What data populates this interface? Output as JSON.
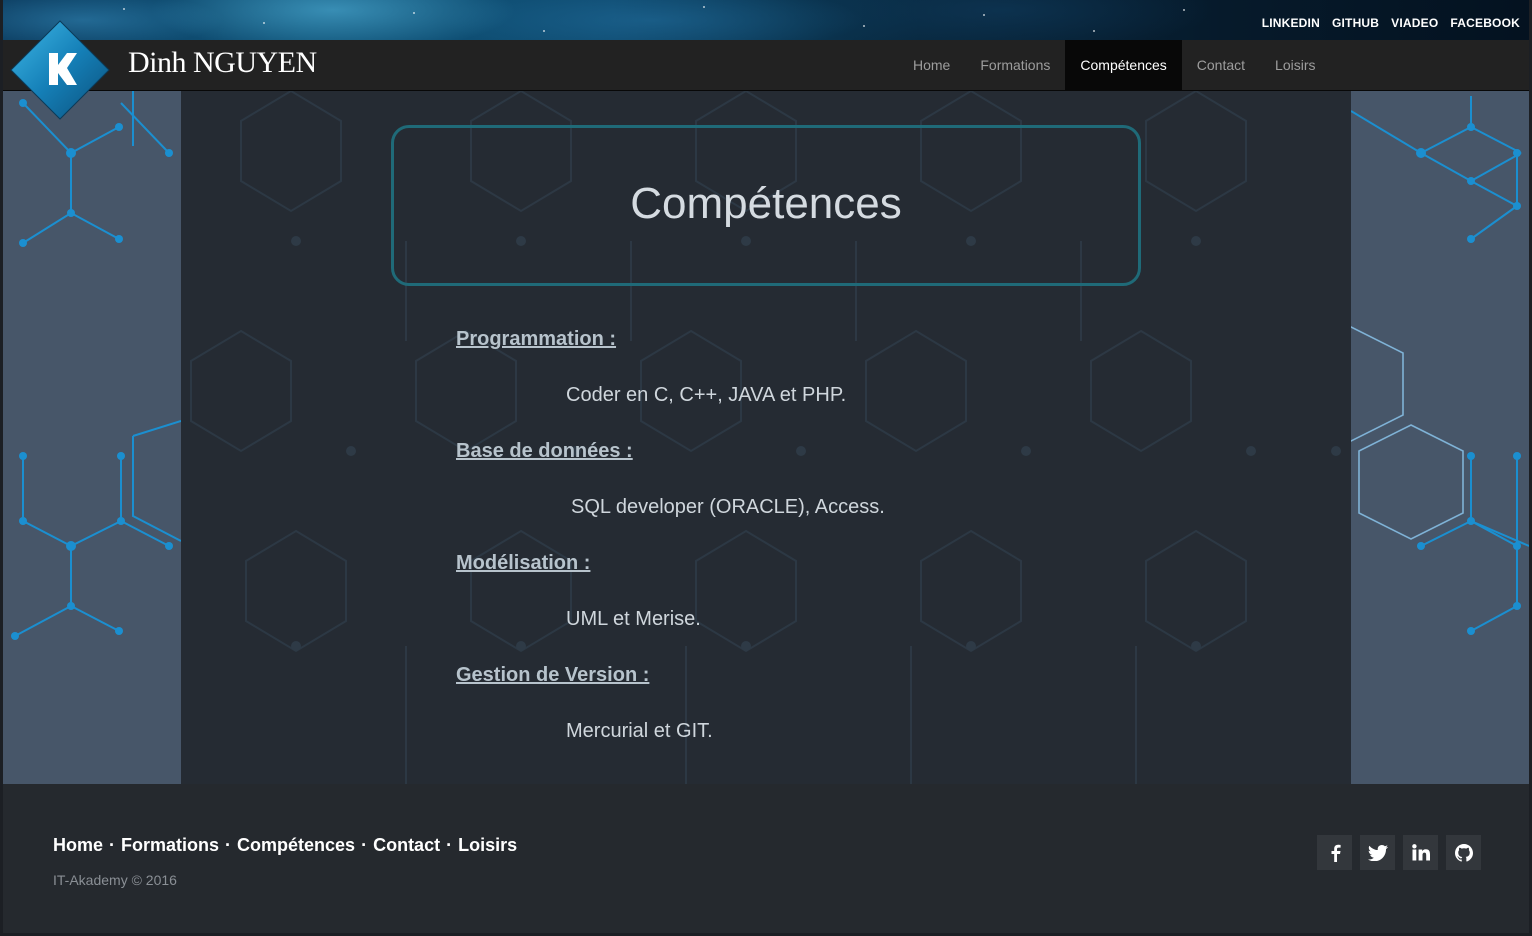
{
  "header": {
    "social_links": [
      "LINKEDIN",
      "GITHUB",
      "VIADEO",
      "FACEBOOK"
    ],
    "brand_name": "Dinh NGUYEN"
  },
  "nav": {
    "items": [
      "Home",
      "Formations",
      "Compétences",
      "Contact",
      "Loisirs"
    ],
    "active": "Compétences"
  },
  "page": {
    "title": "Compétences",
    "sections": [
      {
        "heading": "Programmation :",
        "text": "Coder en C, C++, JAVA et PHP."
      },
      {
        "heading": "Base de données :",
        "text": "SQL developer (ORACLE), Access."
      },
      {
        "heading": "Modélisation :",
        "text": "UML et Merise."
      },
      {
        "heading": "Gestion de Version :",
        "text": "Mercurial et GIT."
      }
    ]
  },
  "footer": {
    "links": [
      "Home",
      "Formations",
      "Compétences",
      "Contact",
      "Loisirs"
    ],
    "separator": "·",
    "copyright": "IT-Akademy © 2016",
    "social_icons": [
      "facebook-icon",
      "twitter-icon",
      "linkedin-icon",
      "github-icon"
    ]
  },
  "colors": {
    "navbar_bg": "#222222",
    "nav_active_bg": "#080808",
    "side_bg": "#475669",
    "content_bg": "#252b33",
    "title_border": "#1f6a78",
    "hex_accent": "#1b8fd0"
  }
}
